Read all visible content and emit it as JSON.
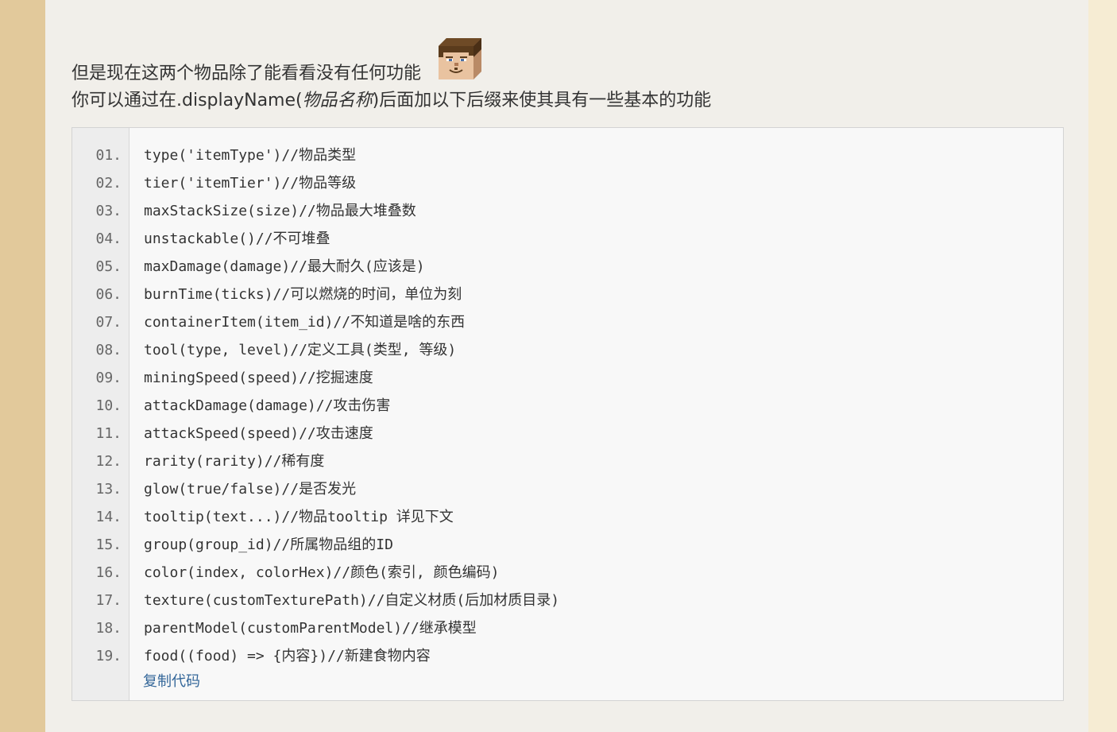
{
  "intro": {
    "line1": "但是现在这两个物品除了能看看没有任何功能",
    "line2_prefix": "你可以通过在.displayName(",
    "line2_italic": "物品名称",
    "line2_suffix": ")后面加以下后缀来使其具有一些基本的功能"
  },
  "emoticon": "steve-face-icon",
  "code_block": {
    "lines": [
      {
        "num": "01.",
        "code": "type('itemType')//物品类型"
      },
      {
        "num": "02.",
        "code": "tier('itemTier')//物品等级"
      },
      {
        "num": "03.",
        "code": "maxStackSize(size)//物品最大堆叠数"
      },
      {
        "num": "04.",
        "code": "unstackable()//不可堆叠"
      },
      {
        "num": "05.",
        "code": "maxDamage(damage)//最大耐久(应该是)"
      },
      {
        "num": "06.",
        "code": "burnTime(ticks)//可以燃烧的时间，单位为刻"
      },
      {
        "num": "07.",
        "code": "containerItem(item_id)//不知道是啥的东西"
      },
      {
        "num": "08.",
        "code": "tool(type, level)//定义工具(类型, 等级)"
      },
      {
        "num": "09.",
        "code": "miningSpeed(speed)//挖掘速度"
      },
      {
        "num": "10.",
        "code": "attackDamage(damage)//攻击伤害"
      },
      {
        "num": "11.",
        "code": "attackSpeed(speed)//攻击速度"
      },
      {
        "num": "12.",
        "code": "rarity(rarity)//稀有度"
      },
      {
        "num": "13.",
        "code": "glow(true/false)//是否发光"
      },
      {
        "num": "14.",
        "code": "tooltip(text...)//物品tooltip 详见下文"
      },
      {
        "num": "15.",
        "code": "group(group_id)//所属物品组的ID"
      },
      {
        "num": "16.",
        "code": "color(index, colorHex)//颜色(索引, 颜色编码)"
      },
      {
        "num": "17.",
        "code": "texture(customTexturePath)//自定义材质(后加材质目录)"
      },
      {
        "num": "18.",
        "code": "parentModel(customParentModel)//继承模型"
      },
      {
        "num": "19.",
        "code": "food((food) => {内容})//新建食物内容"
      }
    ],
    "copy_label": "复制代码"
  },
  "colors": {
    "left_strip": "#e2c99b",
    "right_strip": "#f6ecd3",
    "content_bg": "#f1efea",
    "code_bg": "#f8f8f8",
    "gutter_bg": "#ededed",
    "link": "#336699"
  }
}
